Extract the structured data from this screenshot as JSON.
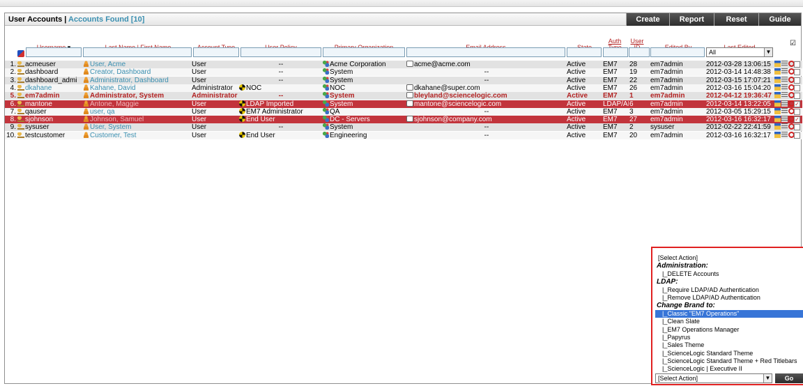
{
  "window": {
    "title": "User Accounts",
    "separator": "|",
    "found_label": "Accounts Found [10]"
  },
  "toolbar": {
    "buttons": [
      "Create",
      "Report",
      "Reset",
      "Guide"
    ]
  },
  "columns": {
    "username": "Username",
    "username_sort": "▾",
    "name": "Last Name | First Name",
    "account_type": "Account Type",
    "user_policy": "User Policy",
    "primary_org": "Primary Organization",
    "email": "Email Address",
    "state": "State",
    "auth_type": "Auth Type",
    "user_id": "User ID",
    "edited_by": "Edited By",
    "last_edited": "Last Edited"
  },
  "filters": {
    "last_edited_value": "All"
  },
  "rows": [
    {
      "num": "1.",
      "username": "acmeuser",
      "name": "User, Acme",
      "type": "User",
      "policy": "--",
      "org": "Acme Corporation",
      "email": "acme@acme.com",
      "state": "Active",
      "auth": "EM7",
      "id": "28",
      "edited_by": "em7admin",
      "last_edited": "2012-03-28 13:06:15",
      "checked": false,
      "style": "g"
    },
    {
      "num": "2.",
      "username": "dashboard",
      "name": "Creator, Dashboard",
      "type": "User",
      "policy": "--",
      "org": "System",
      "email": "--",
      "state": "Active",
      "auth": "EM7",
      "id": "19",
      "edited_by": "em7admin",
      "last_edited": "2012-03-14 14:48:38",
      "checked": false,
      "style": "w"
    },
    {
      "num": "3.",
      "username": "dashboard_admi",
      "name": "Administrator, Dashboard",
      "type": "User",
      "policy": "--",
      "org": "System",
      "email": "--",
      "state": "Active",
      "auth": "EM7",
      "id": "22",
      "edited_by": "em7admin",
      "last_edited": "2012-03-15 17:07:21",
      "checked": false,
      "style": "g"
    },
    {
      "num": "4.",
      "username": "dkahane",
      "name": "Kahane, David",
      "type": "Administrator",
      "policy": "NOC",
      "org": "NOC",
      "email": "dkahane@super.com",
      "state": "Active",
      "auth": "EM7",
      "id": "26",
      "edited_by": "em7admin",
      "last_edited": "2012-03-16 15:04:20",
      "checked": false,
      "style": "w"
    },
    {
      "num": "5.",
      "username": "em7admin",
      "name": "Administrator, System",
      "type": "Administrator",
      "policy": "--",
      "org": "System",
      "email": "bleyland@sciencelogic.com",
      "state": "Active",
      "auth": "EM7",
      "id": "1",
      "edited_by": "em7admin",
      "last_edited": "2012-04-12 19:36:47",
      "checked": false,
      "style": "g hl"
    },
    {
      "num": "6.",
      "username": "mantone",
      "name": "Antone, Maggie",
      "type": "User",
      "policy": "LDAP Imported",
      "org": "System",
      "email": "mantone@sciencelogic.com",
      "state": "Active",
      "auth": "LDAP/AD",
      "id": "6",
      "edited_by": "em7admin",
      "last_edited": "2012-03-14 13:22:05",
      "checked": true,
      "style": "red"
    },
    {
      "num": "7.",
      "username": "qauser",
      "name": "user, qa",
      "type": "User",
      "policy": "EM7 Administrator",
      "org": "QA",
      "email": "--",
      "state": "Active",
      "auth": "EM7",
      "id": "3",
      "edited_by": "em7admin",
      "last_edited": "2012-03-05 15:29:15",
      "checked": false,
      "style": "w"
    },
    {
      "num": "8.",
      "username": "sjohnson",
      "name": "Johnson, Samuel",
      "type": "User",
      "policy": "End User",
      "org": "DC - Servers",
      "email": "sjohnson@company.com",
      "state": "Active",
      "auth": "EM7",
      "id": "27",
      "edited_by": "em7admin",
      "last_edited": "2012-03-16 16:32:17",
      "checked": true,
      "style": "red"
    },
    {
      "num": "9.",
      "username": "sysuser",
      "name": "User, System",
      "type": "User",
      "policy": "--",
      "org": "System",
      "email": "--",
      "state": "Active",
      "auth": "EM7",
      "id": "2",
      "edited_by": "sysuser",
      "last_edited": "2012-02-22 22:41:59",
      "checked": false,
      "style": "g"
    },
    {
      "num": "10.",
      "username": "testcustomer",
      "name": "Customer, Test",
      "type": "User",
      "policy": "End User",
      "org": "Engineering",
      "email": "--",
      "state": "Active",
      "auth": "EM7",
      "id": "20",
      "edited_by": "em7admin",
      "last_edited": "2012-03-16 16:32:17",
      "checked": false,
      "style": "w"
    }
  ],
  "select_all": "☑",
  "action_list": {
    "options": [
      {
        "text": "[Select Action]",
        "kind": "opt"
      },
      {
        "text": "Administration:",
        "kind": "grp"
      },
      {
        "text": "|_DELETE Accounts",
        "kind": "sub"
      },
      {
        "text": "LDAP:",
        "kind": "grp"
      },
      {
        "text": "|_Require LDAP/AD Authentication",
        "kind": "sub"
      },
      {
        "text": "|_Remove LDAP/AD Authentication",
        "kind": "sub"
      },
      {
        "text": "Change Brand to:",
        "kind": "grp"
      },
      {
        "text": "|_Classic \"EM7 Operations\"",
        "kind": "sub sel"
      },
      {
        "text": "|_Clean Slate",
        "kind": "sub"
      },
      {
        "text": "|_EM7 Operations Manager",
        "kind": "sub"
      },
      {
        "text": "|_Papyrus",
        "kind": "sub"
      },
      {
        "text": "|_Sales Theme",
        "kind": "sub"
      },
      {
        "text": "|_ScienceLogic Standard Theme",
        "kind": "sub"
      },
      {
        "text": "|_ScienceLogic Standard Theme + Red Titlebars",
        "kind": "sub"
      },
      {
        "text": "|_ScienceLogic | Executive II",
        "kind": "sub"
      }
    ],
    "select_value": "[Select Action]",
    "go_label": "Go"
  }
}
